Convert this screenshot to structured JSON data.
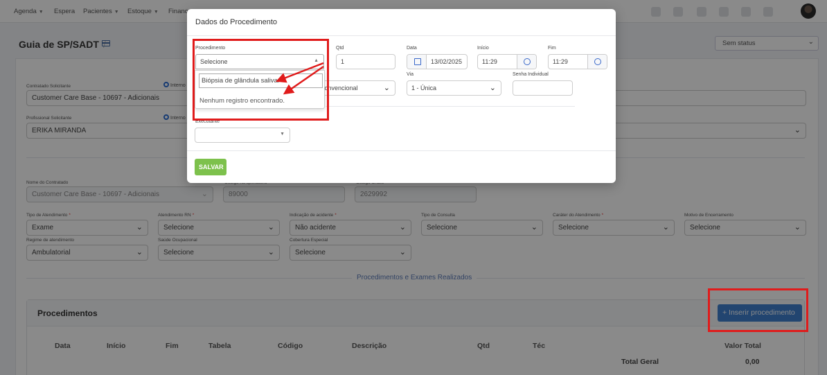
{
  "nav": {
    "agenda": "Agenda",
    "espera": "Espera",
    "pacientes": "Pacientes",
    "estoque": "Estoque",
    "financeiro": "Financ"
  },
  "page": {
    "title": "Guia de SP/SADT",
    "sep": "/",
    "status": "Sem status"
  },
  "form": {
    "contratado_solicitante_label": "Contratado Solicitante",
    "contratado_solicitante": "Customer Care Base - 10697 - Adicionais",
    "interno_label": "Interno",
    "profissional_label": "Profissional Solicitante",
    "profissional": "ERIKA MIRANDA",
    "nome_contratado_label": "Nome do Contratado",
    "nome_contratado": "Customer Care Base - 10697 - Adicionais",
    "codigo_operadora_label": "Código na operadora",
    "codigo_operadora": "89000",
    "codigo_cnes_label": "Código CNES",
    "codigo_cnes": "2629992",
    "tipo_atendimento_label": "Tipo de Atendimento",
    "tipo_atendimento": "Exame",
    "atendimento_rn_label": "Atendimento RN",
    "atendimento_rn": "Selecione",
    "indicacao_acidente_label": "Indicação de acidente",
    "indicacao_acidente": "Não acidente",
    "tipo_consulta_label": "Tipo de Consulta",
    "tipo_consulta": "Selecione",
    "carater_label": "Caráter do Atendimento",
    "carater": "Selecione",
    "motivo_label": "Motivo de Encerramento",
    "motivo": "Selecione",
    "regime_label": "Regime de atendimento",
    "regime": "Ambulatorial",
    "saude_ocupacional_label": "Saúde Ocupacional",
    "saude_ocupacional": "Selecione",
    "cobertura_label": "Cobertura Especial",
    "cobertura": "Selecione",
    "required_mark": "*"
  },
  "section": {
    "title": "Procedimentos e Exames Realizados"
  },
  "procedimentos": {
    "title": "Procedimentos",
    "insert_button": "+ Inserir procedimento",
    "columns": [
      "Data",
      "Início",
      "Fim",
      "Tabela",
      "Código",
      "Descrição",
      "Qtd",
      "Téc",
      "Valor Total"
    ],
    "total_label": "Total Geral",
    "total_value": "0,00"
  },
  "modal": {
    "title": "Dados do Procedimento",
    "procedimento_label": "Procedimento",
    "procedimento_value": "Selecione",
    "qtd_label": "Qtd",
    "qtd_value": "1",
    "data_label": "Data",
    "data_value": "13/02/2025",
    "inicio_label": "Início",
    "inicio_value": "11:29",
    "fim_label": "Fim",
    "fim_value": "11:29",
    "tecnica_value": "Convencional",
    "via_label": "Via",
    "via_value": "1 - Única",
    "senha_label": "Senha Individual",
    "senha_value": "",
    "executante_label": "Executante",
    "salvar": "SALVAR",
    "dropdown_search": "Biópsia de glândula salivar",
    "dropdown_empty": "Nenhum registro encontrado."
  },
  "colors": {
    "highlight": "#e01b1b",
    "primary": "#3f80d0",
    "success": "#7dc14c"
  }
}
